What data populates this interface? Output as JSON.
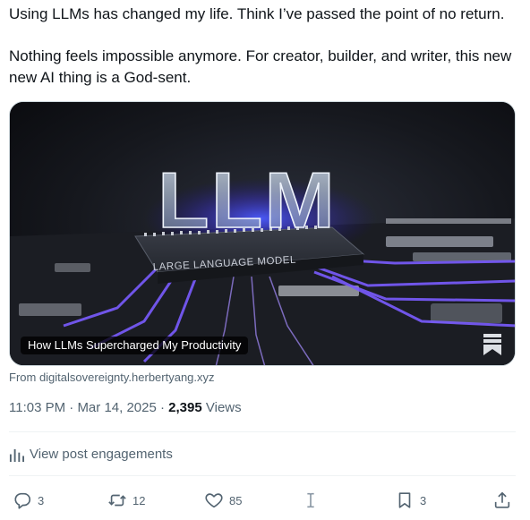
{
  "post": {
    "paragraphs": [
      "Using LLMs has changed my life. Think I’ve passed the point of no return.",
      "Nothing feels impossible anymore. For creator, builder, and writer, this new new AI thing is a God-sent."
    ]
  },
  "card": {
    "image_title": "LLM",
    "image_chip_label": "LARGE LANGUAGE MODEL",
    "caption": "How LLMs Supercharged My Productivity",
    "source": "From digitalsovereignty.herbertyang.xyz",
    "icon": "bookmark-ribbon-icon"
  },
  "meta": {
    "time": "11:03 PM",
    "date": "Mar 14, 2025",
    "separator": "·",
    "views_count": "2,395",
    "views_label": "Views"
  },
  "engagements": {
    "label": "View post engagements",
    "icon": "analytics-bars-icon"
  },
  "actions": {
    "reply": {
      "count": "3",
      "icon": "reply-bubble-icon"
    },
    "repost": {
      "count": "12",
      "icon": "repost-arrows-icon"
    },
    "like": {
      "count": "85",
      "icon": "heart-icon"
    },
    "grok": {
      "icon": "text-cursor-icon"
    },
    "bookmark": {
      "count": "3",
      "icon": "bookmark-icon"
    },
    "share": {
      "icon": "share-upload-icon"
    }
  },
  "colors": {
    "text": "#0f1419",
    "secondary": "#536471",
    "divider": "#eff3f4",
    "accent_glow": "#6a4cff"
  }
}
